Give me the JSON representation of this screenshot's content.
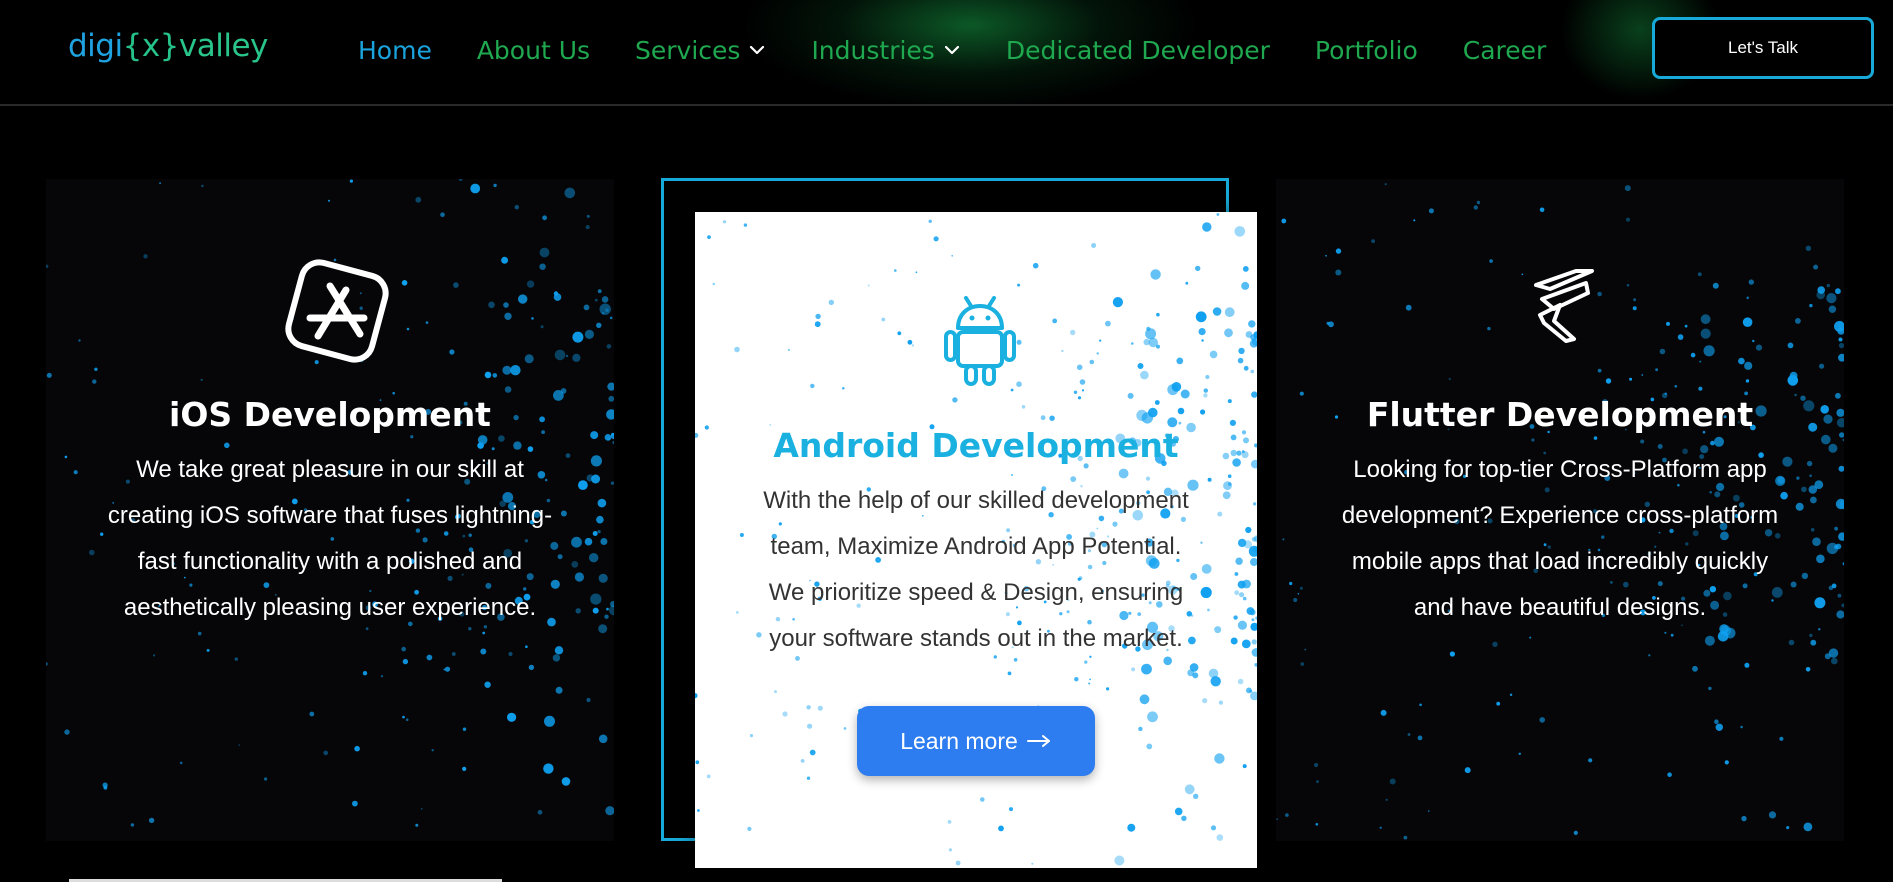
{
  "header": {
    "logo": {
      "part1": "digi",
      "part2": "{x}",
      "part3": "valley"
    },
    "nav": [
      {
        "label": "Home",
        "active": true,
        "has_dropdown": false
      },
      {
        "label": "About Us",
        "active": false,
        "has_dropdown": false
      },
      {
        "label": "Services",
        "active": false,
        "has_dropdown": true
      },
      {
        "label": "Industries",
        "active": false,
        "has_dropdown": true
      },
      {
        "label": "Dedicated Developer",
        "active": false,
        "has_dropdown": false
      },
      {
        "label": "Portfolio",
        "active": false,
        "has_dropdown": false
      },
      {
        "label": "Career",
        "active": false,
        "has_dropdown": false
      }
    ],
    "cta_label": "Let's Talk"
  },
  "cards": [
    {
      "title": "iOS Development",
      "icon": "app-store-icon",
      "description_lines": [
        "We take great pleasure in our skill at",
        "creating iOS software that fuses lightning-",
        "fast functionality with a polished and",
        "aesthetically pleasing user experience."
      ]
    },
    {
      "title": "Android Development",
      "icon": "android-icon",
      "description_lines": [
        "With the help of our skilled development",
        "team, Maximize Android App Potential.",
        "We prioritize speed & Design, ensuring",
        "your software stands out in the market."
      ],
      "button_label": "Learn more"
    },
    {
      "title": "Flutter Development",
      "icon": "flutter-icon",
      "description_lines": [
        "Looking for top-tier Cross-Platform app",
        "development? Experience cross-platform",
        "mobile apps that load incredibly quickly",
        "and have beautiful designs."
      ]
    }
  ],
  "colors": {
    "background": "#000000",
    "nav_link": "#1fa84f",
    "nav_active": "#1aa3dd",
    "accent_blue": "#17a9d8",
    "button_blue": "#2d7cf0",
    "particle": "#0fa0f0"
  }
}
